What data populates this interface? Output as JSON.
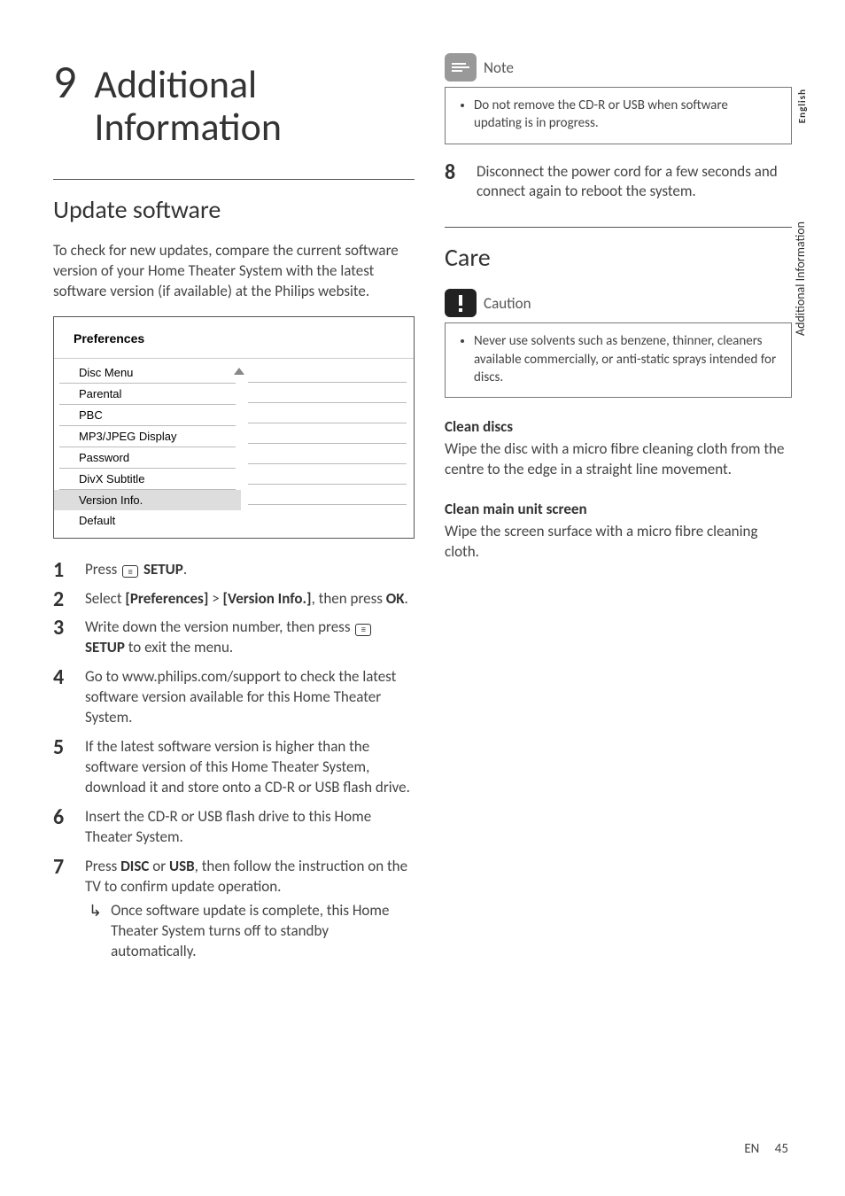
{
  "chapter": {
    "number": "9",
    "title": "Additional Information"
  },
  "sideTabs": {
    "language": "English",
    "section": "Additional Information"
  },
  "leftColumn": {
    "section1": {
      "heading": "Update software",
      "intro": "To check for new updates, compare the current software version of your Home Theater System with the latest software version (if available) at the Philips website."
    },
    "menu": {
      "title": "Preferences",
      "items": [
        "Disc Menu",
        "Parental",
        "PBC",
        "MP3/JPEG Display",
        "Password",
        "DivX Subtitle",
        "Version Info.",
        "Default"
      ],
      "selectedIndex": 6,
      "scrollArrowAtIndex": 0
    },
    "steps": [
      {
        "parts": [
          {
            "t": "Press "
          },
          {
            "icon": "setup"
          },
          {
            "t": " "
          },
          {
            "b": "SETUP"
          },
          {
            "t": "."
          }
        ]
      },
      {
        "parts": [
          {
            "t": "Select "
          },
          {
            "b": "[Preferences]"
          },
          {
            "t": " > "
          },
          {
            "b": "[Version Info.]"
          },
          {
            "t": ", then press "
          },
          {
            "b": "OK"
          },
          {
            "t": "."
          }
        ]
      },
      {
        "parts": [
          {
            "t": "Write down the version number, then press "
          },
          {
            "icon": "setup"
          },
          {
            "t": " "
          },
          {
            "b": "SETUP"
          },
          {
            "t": " to exit the menu."
          }
        ]
      },
      {
        "parts": [
          {
            "t": "Go to www.philips.com/support to check the latest software version available for this Home Theater System."
          }
        ]
      },
      {
        "parts": [
          {
            "t": "If the latest software version is higher than the software version of this Home Theater System, download it and store onto a CD-R or USB flash drive."
          }
        ]
      },
      {
        "parts": [
          {
            "t": "Insert the CD-R or USB flash drive to this Home Theater System."
          }
        ]
      },
      {
        "parts": [
          {
            "t": "Press "
          },
          {
            "b": "DISC"
          },
          {
            "t": " or "
          },
          {
            "b": "USB"
          },
          {
            "t": ", then follow the instruction on the TV to confirm update operation."
          }
        ],
        "result": "Once software update is complete, this Home Theater System turns off to standby automatically."
      }
    ]
  },
  "rightColumn": {
    "note": {
      "title": "Note",
      "items": [
        "Do not remove the CD-R or USB when software updating is in progress."
      ]
    },
    "step8": {
      "number": "8",
      "text": "Disconnect the power cord for a few seconds and connect again to reboot the system."
    },
    "careHeading": "Care",
    "caution": {
      "title": "Caution",
      "items": [
        "Never use solvents such as benzene, thinner, cleaners available commercially, or anti-static sprays intended for discs."
      ]
    },
    "cleanDiscs": {
      "heading": "Clean discs",
      "body": "Wipe the disc with a micro fibre cleaning cloth from the centre to the edge in a straight line movement."
    },
    "cleanScreen": {
      "heading": "Clean main unit screen",
      "body": "Wipe the screen surface with a micro fibre cleaning cloth."
    }
  },
  "footer": {
    "langCode": "EN",
    "pageNumber": "45"
  }
}
